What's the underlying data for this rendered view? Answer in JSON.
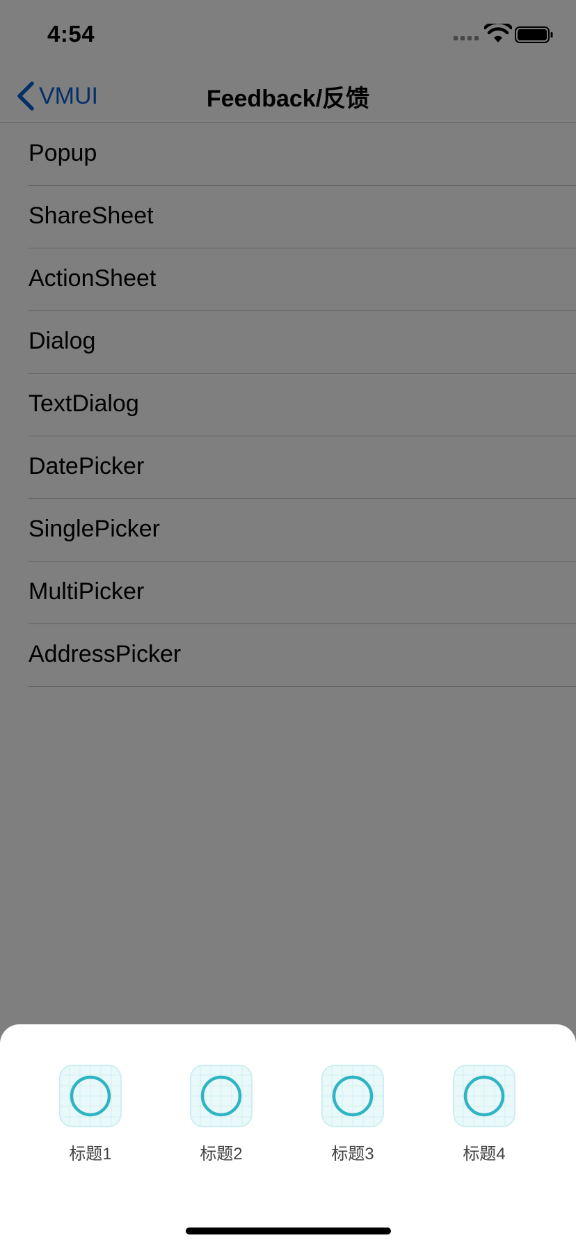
{
  "status_bar": {
    "time": "4:54"
  },
  "nav": {
    "back_label": "VMUI",
    "title": "Feedback/反馈"
  },
  "list": {
    "items": [
      {
        "label": "Popup"
      },
      {
        "label": "ShareSheet"
      },
      {
        "label": "ActionSheet"
      },
      {
        "label": "Dialog"
      },
      {
        "label": "TextDialog"
      },
      {
        "label": "DatePicker"
      },
      {
        "label": "SinglePicker"
      },
      {
        "label": "MultiPicker"
      },
      {
        "label": "AddressPicker"
      }
    ]
  },
  "share_sheet": {
    "items": [
      {
        "label": "标题1",
        "icon": "placeholder-app-icon"
      },
      {
        "label": "标题2",
        "icon": "placeholder-app-icon"
      },
      {
        "label": "标题3",
        "icon": "placeholder-app-icon"
      },
      {
        "label": "标题4",
        "icon": "placeholder-app-icon"
      }
    ]
  },
  "colors": {
    "accent": "#0a61ce",
    "overlay": "rgba(0,0,0,0.5)",
    "icon_ring": "#2fb4c4",
    "separator": "#c8c7cc"
  }
}
